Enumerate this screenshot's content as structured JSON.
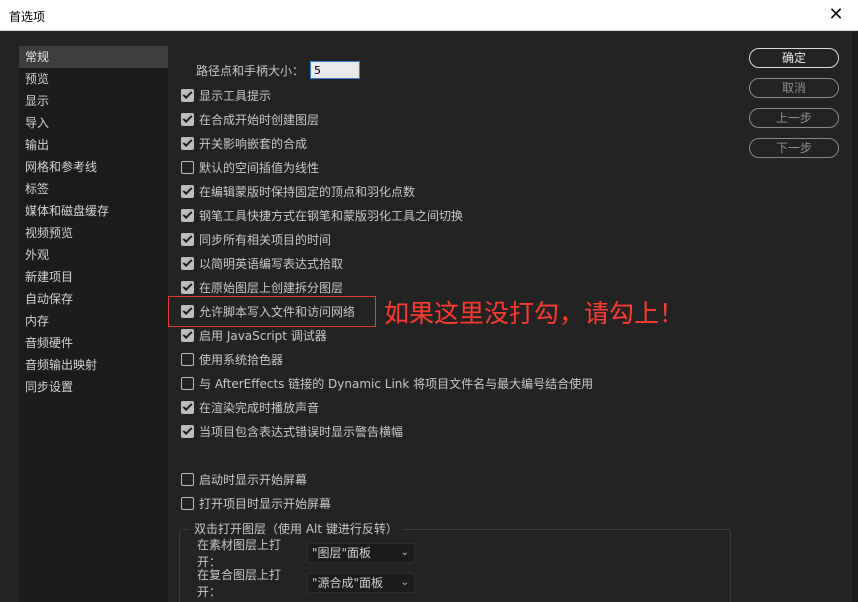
{
  "window": {
    "title": "首选项",
    "close_glyph": "✕"
  },
  "sidebar": {
    "items": [
      {
        "label": "常规",
        "selected": true
      },
      {
        "label": "预览"
      },
      {
        "label": "显示"
      },
      {
        "label": "导入"
      },
      {
        "label": "输出"
      },
      {
        "label": "网格和参考线"
      },
      {
        "label": "标签"
      },
      {
        "label": "媒体和磁盘缓存"
      },
      {
        "label": "视频预览"
      },
      {
        "label": "外观"
      },
      {
        "label": "新建项目"
      },
      {
        "label": "自动保存"
      },
      {
        "label": "内存"
      },
      {
        "label": "音频硬件"
      },
      {
        "label": "音频输出映射"
      },
      {
        "label": "同步设置"
      }
    ]
  },
  "main": {
    "path_handle_label": "路径点和手柄大小：",
    "path_handle_value": "5",
    "checkboxes": [
      {
        "label": "显示工具提示",
        "checked": true
      },
      {
        "label": "在合成开始时创建图层",
        "checked": true
      },
      {
        "label": "开关影响嵌套的合成",
        "checked": true
      },
      {
        "label": "默认的空间插值为线性",
        "checked": false
      },
      {
        "label": "在编辑蒙版时保持固定的顶点和羽化点数",
        "checked": true
      },
      {
        "label": "钢笔工具快捷方式在钢笔和蒙版羽化工具之间切换",
        "checked": true
      },
      {
        "label": "同步所有相关项目的时间",
        "checked": true
      },
      {
        "label": "以简明英语编写表达式拾取",
        "checked": true
      },
      {
        "label": "在原始图层上创建拆分图层",
        "checked": true
      },
      {
        "label": "允许脚本写入文件和访问网络",
        "checked": true
      },
      {
        "label": "启用 JavaScript 调试器",
        "checked": true
      },
      {
        "label": "使用系统拾色器",
        "checked": false
      },
      {
        "label": "与 AfterEffects 链接的 Dynamic Link 将项目文件名与最大编号结合使用",
        "checked": false
      },
      {
        "label": "在渲染完成时播放声音",
        "checked": true
      },
      {
        "label": "当项目包含表达式错误时显示警告横幅",
        "checked": true
      },
      {
        "label": "启动时显示开始屏幕",
        "checked": false
      },
      {
        "label": "打开项目时显示开始屏幕",
        "checked": false
      }
    ],
    "annotation_text": "如果这里没打勾，请勾上！",
    "group": {
      "legend": "双击打开图层（使用 Alt 键进行反转）",
      "rows": [
        {
          "label": "在素材图层上打开：",
          "value": "\"图层\"面板"
        },
        {
          "label": "在复合图层上打开：",
          "value": "\"源合成\"面板"
        }
      ]
    }
  },
  "buttons": {
    "ok": "确定",
    "cancel": "取消",
    "prev": "上一步",
    "next": "下一步"
  },
  "colors": {
    "background": "#232323",
    "annotation": "#ff3b30",
    "input_focus": "#3b7fd4"
  }
}
